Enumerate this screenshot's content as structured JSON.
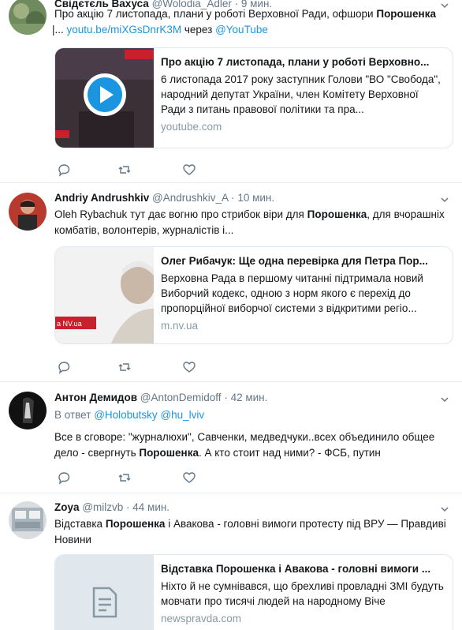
{
  "tweets": [
    {
      "name": "Свідєтєль Вахуса",
      "handle": "@Wolodia_Adler",
      "time": "9 мин.",
      "text_a": "Про акцію 7 листопада, плани у роботі Верховної Ради, офшори ",
      "text_bold": "Порошенка",
      "text_b": " |...",
      "link": "youtu.be/miXGsDnrK3M",
      "via": "через",
      "via_link": "@YouTube",
      "card": {
        "title": "Про акцію 7 листопада, плани у роботі Верховно...",
        "desc": "6 листопада 2017 року заступник Голови \"ВО \"Свобода\", народний депутат України, член Комітету Верховної Ради з питань правової політики та пра...",
        "domain": "youtube.com"
      }
    },
    {
      "name": "Andriy Andrushkiv",
      "handle": "@Andrushkiv_A",
      "time": "10 мин.",
      "text_a": "Oleh Rybachuk тут дає вогню про стрибок віри для ",
      "text_bold": "Порошенка",
      "text_b": ", для вчорашніх комбатів, волонтерів, журналістів і...",
      "card": {
        "title": "Олег Рибачук: Ще одна перевірка для Петра Пор...",
        "desc": "Верховна Рада в першому читанні підтримала новий Виборчий кодекс, одною з норм якого є перехід до пропорційної виборчої системи з відкритими регіо...",
        "domain": "m.nv.ua",
        "thumb_label": "a NV.ua"
      }
    },
    {
      "name": "Антон Демидов",
      "handle": "@AntonDemidoff",
      "time": "42 мин.",
      "reply_prefix": "В ответ",
      "reply_to_1": "@Holobutsky",
      "reply_to_2": "@hu_lviv",
      "text_a": "Все в сговоре: \"журналюхи\", Савченки, медведчуки..всех объединило общее дело - свергнуть ",
      "text_bold": "Порошенка",
      "text_b": ". А кто стоит над ними? - ФСБ, путин"
    },
    {
      "name": "Zoya",
      "handle": "@milzvb",
      "time": "44 мин.",
      "text_a": "Відставка ",
      "text_bold": "Порошенка",
      "text_b": " і Авакова - головні вимоги протесту під ВРУ — Правдиві Новини",
      "card": {
        "title": "Відставка Порошенка і Авакова - головні вимоги ...",
        "desc": "Ніхто й не сумнівався, що брехливі провладні ЗМІ будуть мовчати про тисячі людей на народному Віче",
        "domain": "newspravda.com"
      }
    }
  ],
  "icons": [
    "reply-icon",
    "retweet-icon",
    "like-icon",
    "caret-down-icon",
    "play-icon",
    "document-icon"
  ],
  "colors": {
    "link": "#1b95e0",
    "meta": "#657786",
    "border": "#e6ecf0",
    "domain": "#8899a6"
  }
}
